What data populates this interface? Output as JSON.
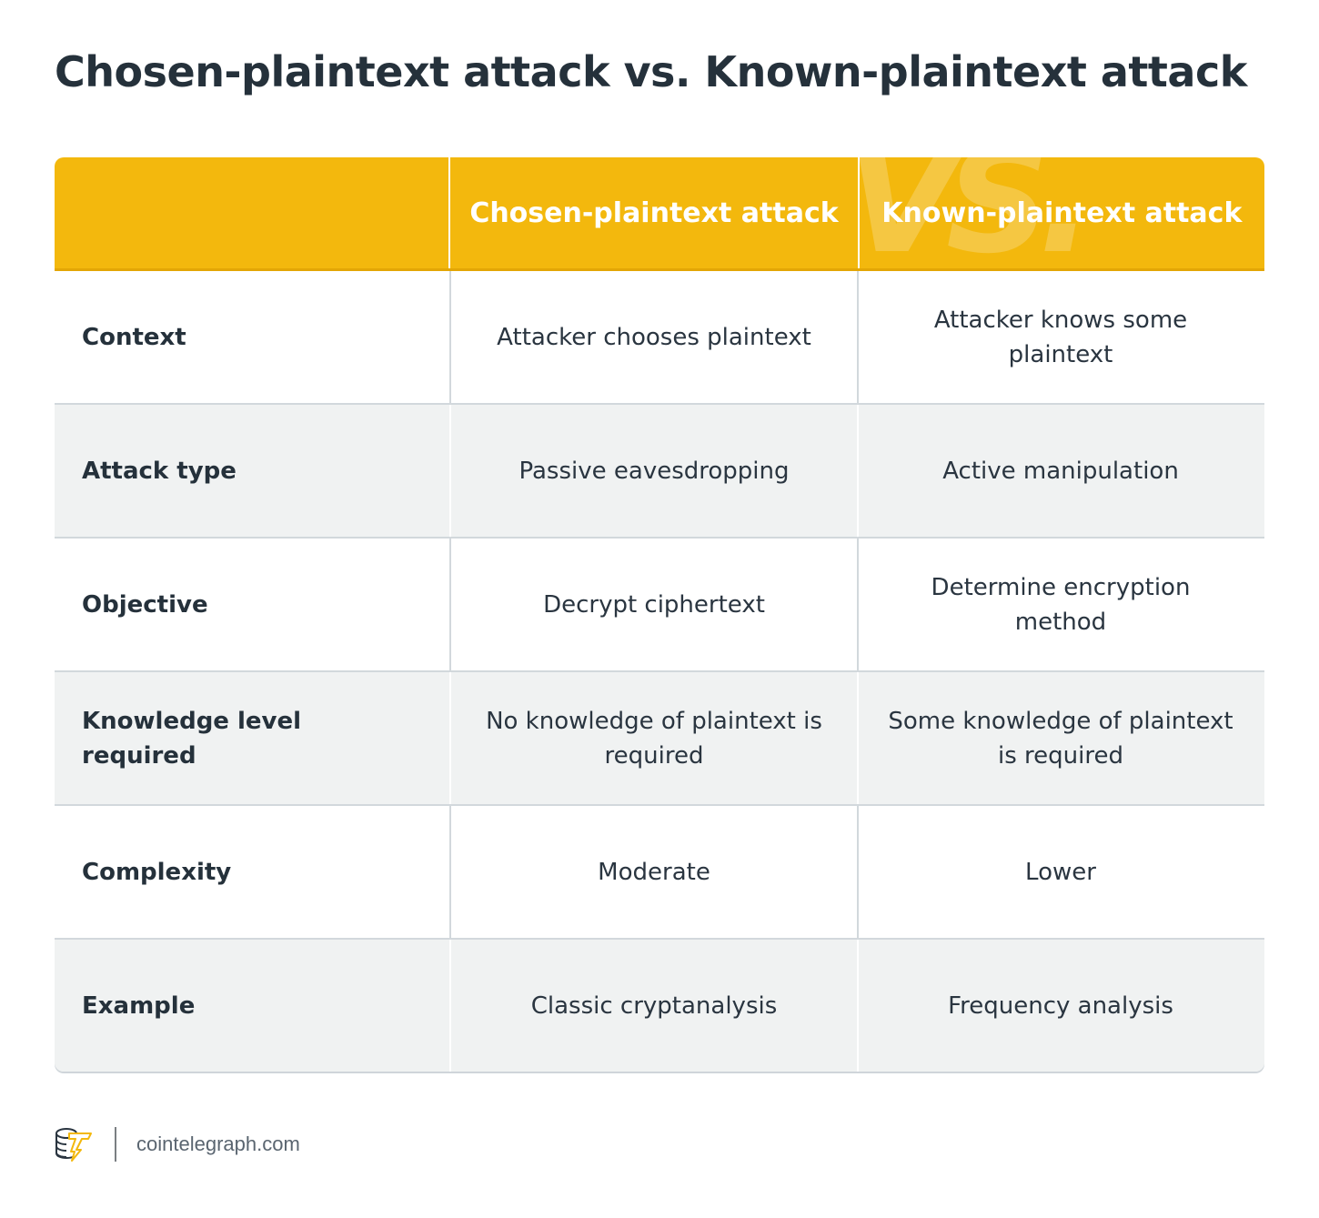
{
  "title": "Chosen-plaintext attack vs. Known-plaintext attack",
  "header": {
    "col0": "",
    "col1": "Chosen-plaintext attack",
    "col2": "Known-plaintext attack",
    "watermark": "VS."
  },
  "rows": [
    {
      "label": "Context",
      "chosen": "Attacker chooses plaintext",
      "known": "Attacker knows some plaintext"
    },
    {
      "label": "Attack type",
      "chosen": "Passive eavesdropping",
      "known": "Active manipulation"
    },
    {
      "label": "Objective",
      "chosen": "Decrypt ciphertext",
      "known": "Determine encryption method"
    },
    {
      "label": "Knowledge level required",
      "chosen": "No knowledge of plaintext is required",
      "known": "Some knowledge of plaintext is required"
    },
    {
      "label": "Complexity",
      "chosen": "Moderate",
      "known": "Lower"
    },
    {
      "label": "Example",
      "chosen": "Classic cryptanalysis",
      "known": "Frequency analysis"
    }
  ],
  "footer": {
    "logo_icon": "cointelegraph-logo-icon",
    "site": "cointelegraph.com"
  },
  "colors": {
    "header_bg": "#f3b80d",
    "alt_row_bg": "#f0f2f2",
    "text": "#25313b"
  }
}
